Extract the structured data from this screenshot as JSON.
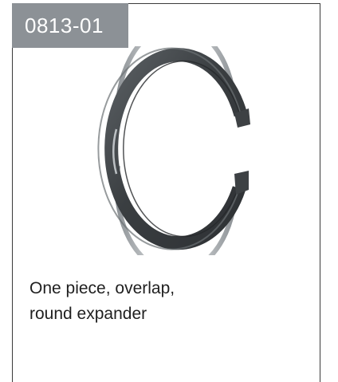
{
  "product": {
    "code": "0813-01",
    "description_lines": [
      "One piece, overlap,",
      "round expander"
    ],
    "image_icon": "piston-ring-icon",
    "colors": {
      "badge_bg": "#8c9196",
      "badge_text": "#ffffff",
      "border": "#3a3a3a",
      "ring_dark": "#3d4144",
      "ring_light": "#6b7074",
      "expander_wire": "#c9cdd0"
    }
  }
}
